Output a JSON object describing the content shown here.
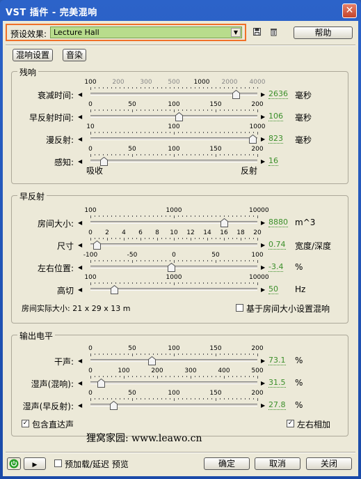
{
  "window": {
    "title": "VST 插件 - 完美混响",
    "close": "✕"
  },
  "preset": {
    "label": "预设效果:",
    "value": "Lecture Hall",
    "help": "帮助"
  },
  "tabs": [
    "混响设置",
    "音染"
  ],
  "groups": {
    "reverb": "残响",
    "early": "早反射",
    "output": "输出电平"
  },
  "sliders": [
    {
      "label": "衰减时间:",
      "scale": [
        "100",
        "200",
        "300",
        "500",
        "1000",
        "2000",
        "4000"
      ],
      "scale_gray": [
        false,
        true,
        true,
        true,
        false,
        true,
        true
      ],
      "value": "2636",
      "unit": "毫秒",
      "pos": 0.87
    },
    {
      "label": "早反射时间:",
      "scale": [
        "0",
        "50",
        "100",
        "150",
        "200"
      ],
      "value": "106",
      "unit": "毫秒",
      "pos": 0.53
    },
    {
      "label": "漫反射:",
      "scale": [
        "10",
        "100",
        "1000"
      ],
      "value": "823",
      "unit": "毫秒",
      "pos": 0.97
    },
    {
      "label": "感知:",
      "scale": [
        "0",
        "50",
        "100",
        "150",
        "200"
      ],
      "value": "16",
      "unit": "",
      "pos": 0.08,
      "sub_left": "吸收",
      "sub_right": "反射"
    },
    {
      "label": "房间大小:",
      "scale": [
        "100",
        "1000",
        "10000"
      ],
      "value": "8880",
      "unit": "m^3",
      "pos": 0.8
    },
    {
      "label": "尺寸",
      "scale": [
        "0",
        "2",
        "4",
        "6",
        "8",
        "10",
        "12",
        "14",
        "16",
        "18",
        "20"
      ],
      "value": "0.74",
      "unit": "宽度/深度",
      "pos": 0.037
    },
    {
      "label": "左右位置:",
      "scale": [
        "-100",
        "-50",
        "0",
        "50",
        "100"
      ],
      "value": "-3.4",
      "unit": "%",
      "pos": 0.483
    },
    {
      "label": "高切",
      "scale": [
        "100",
        "1000",
        "10000"
      ],
      "value": "50",
      "unit": "Hz",
      "pos": 0.14
    },
    {
      "label": "干声:",
      "scale": [
        "0",
        "50",
        "100",
        "150",
        "200"
      ],
      "value": "73.1",
      "unit": "%",
      "pos": 0.365
    },
    {
      "label": "湿声(混响):",
      "scale": [
        "0",
        "100",
        "200",
        "300",
        "400",
        "500"
      ],
      "value": "31.5",
      "unit": "%",
      "pos": 0.063
    },
    {
      "label": "湿声(早反射):",
      "scale": [
        "0",
        "50",
        "100",
        "150",
        "200"
      ],
      "value": "27.8",
      "unit": "%",
      "pos": 0.139
    }
  ],
  "room_info": "房间实际大小: 21 x 29 x 13 m",
  "room_check": "基于房间大小设置混响",
  "include_direct": "包含直达声",
  "lr_sum": "左右相加",
  "watermark": "狸窝家园: www.leawo.cn",
  "footer": {
    "preload": "预加载/延迟 预览",
    "ok": "确定",
    "cancel": "取消",
    "close": "关闭"
  }
}
